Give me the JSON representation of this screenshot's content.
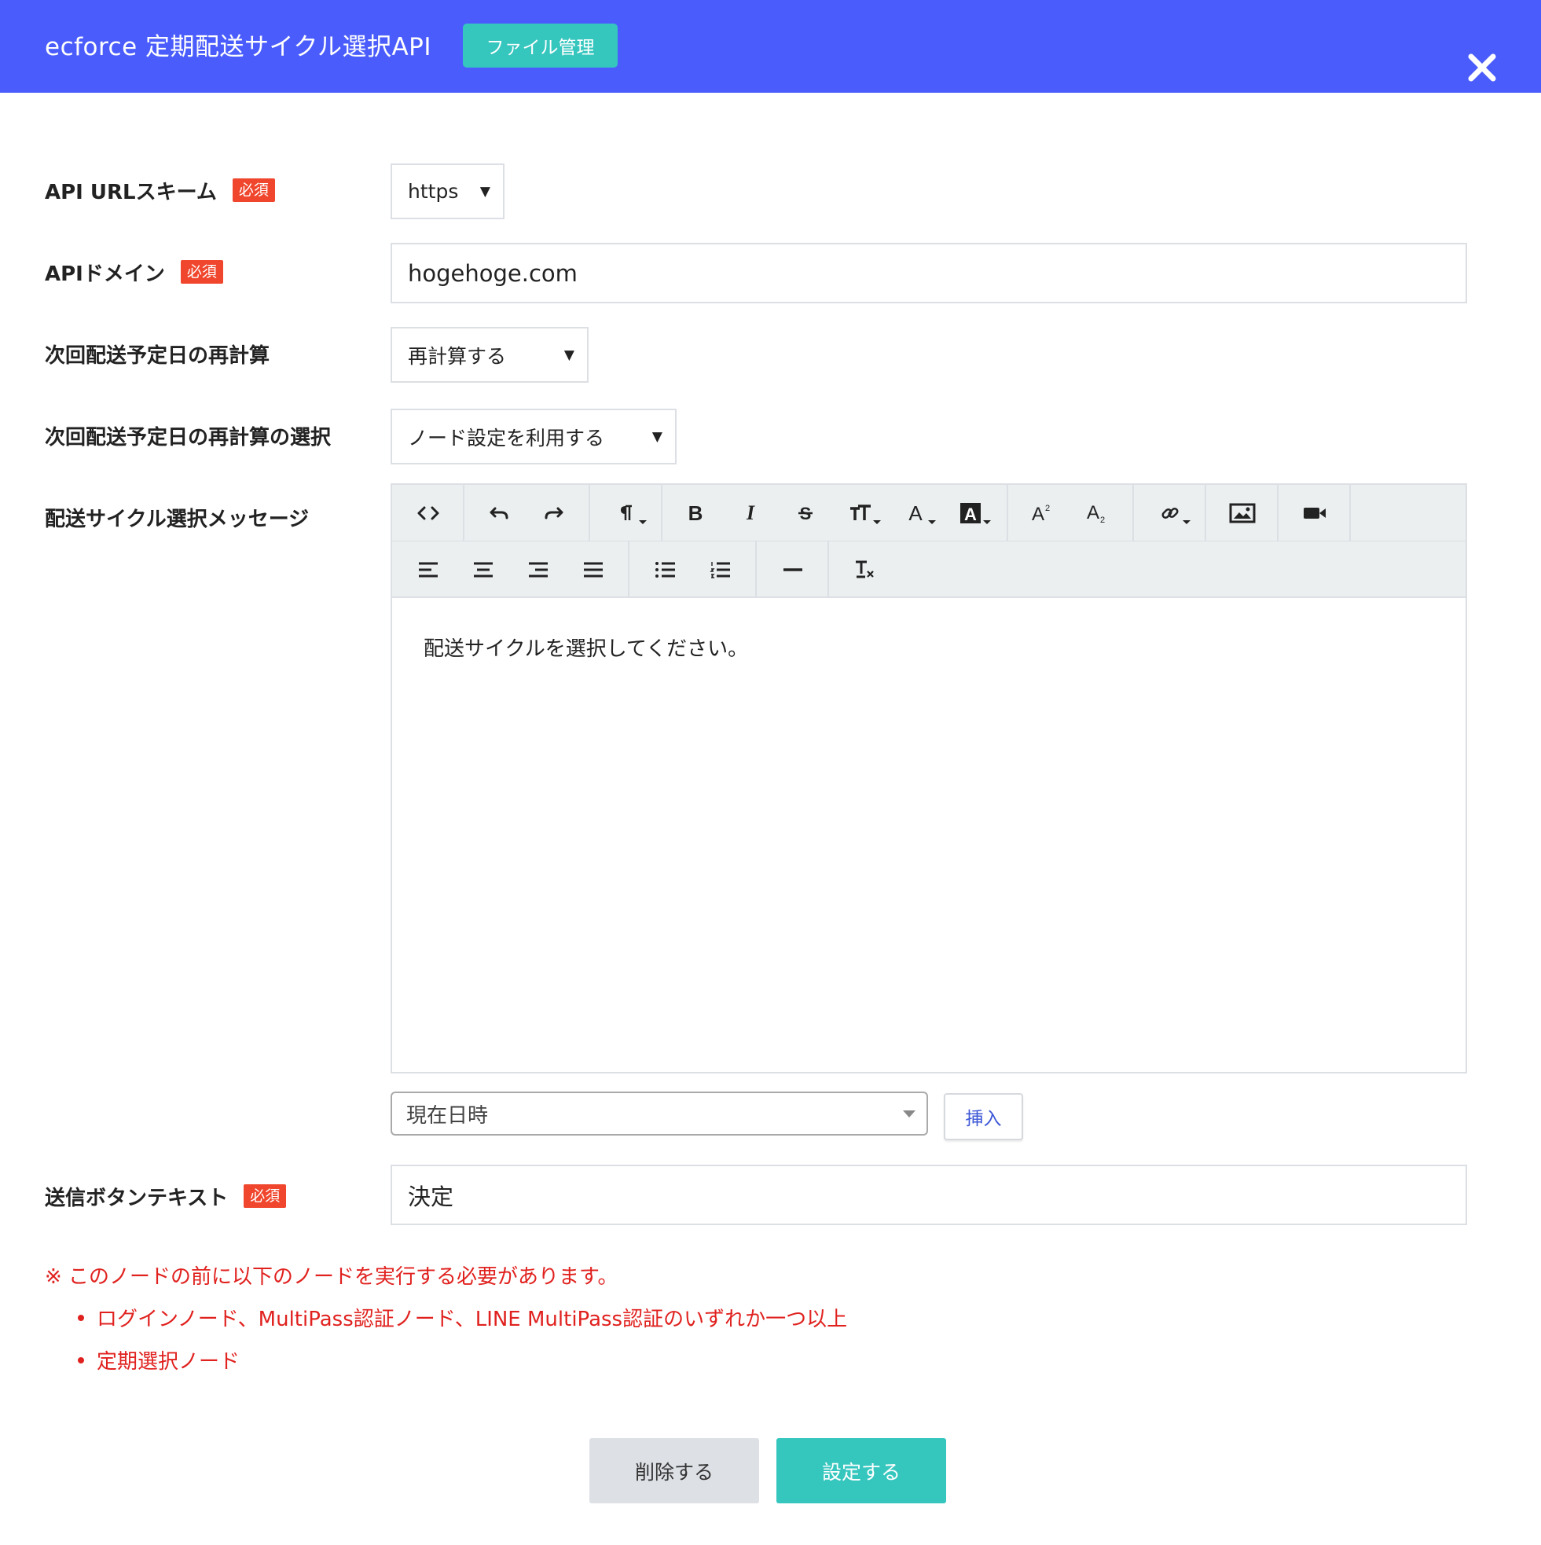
{
  "header": {
    "title": "ecforce 定期配送サイクル選択API",
    "file_button": "ファイル管理",
    "close_icon": "close-icon",
    "bg_color": "#4a5dfc",
    "accent_color": "#35c6be"
  },
  "form": {
    "required_badge": "必須",
    "scheme": {
      "label": "API URLスキーム",
      "value": "https"
    },
    "domain": {
      "label": "APIドメイン",
      "value": "hogehoge.com"
    },
    "recalc": {
      "label": "次回配送予定日の再計算",
      "value": "再計算する"
    },
    "recalc_select": {
      "label": "次回配送予定日の再計算の選択",
      "value": "ノード設定を利用する"
    },
    "message": {
      "label": "配送サイクル選択メッセージ",
      "content": "配送サイクルを選択してください。",
      "toolbar_row1": [
        "code-view-icon",
        "undo-icon",
        "redo-icon",
        "paragraph-icon",
        "bold-icon",
        "italic-icon",
        "strikethrough-icon",
        "font-size-icon",
        "font-color-icon",
        "background-color-icon",
        "superscript-icon",
        "subscript-icon",
        "link-icon",
        "image-icon",
        "video-icon"
      ],
      "toolbar_row2": [
        "align-left-icon",
        "align-center-icon",
        "align-right-icon",
        "align-justify-icon",
        "bullet-list-icon",
        "numbered-list-icon",
        "horizontal-rule-icon",
        "clear-format-icon"
      ]
    },
    "variable": {
      "selected": "現在日時",
      "insert_button": "挿入"
    },
    "submit_text": {
      "label": "送信ボタンテキスト",
      "value": "決定"
    }
  },
  "notes": {
    "heading": "※ このノードの前に以下のノードを実行する必要があります。",
    "items": [
      "ログインノード、MultiPass認証ノード、LINE MultiPass認証のいずれか一つ以上",
      "定期選択ノード"
    ],
    "color": "#e0221f"
  },
  "actions": {
    "delete": "削除する",
    "save": "設定する"
  }
}
